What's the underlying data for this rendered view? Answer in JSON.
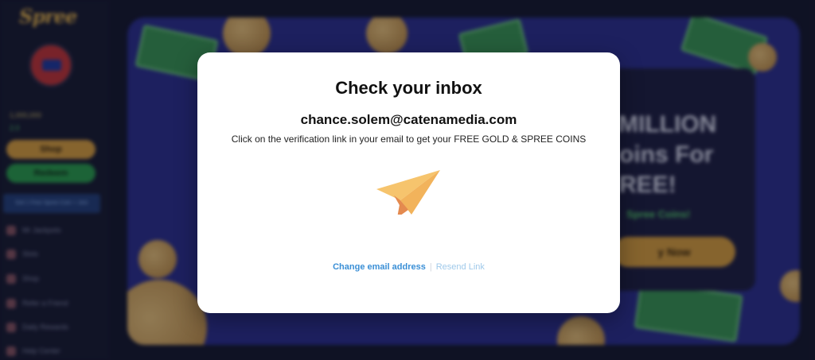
{
  "sidebar": {
    "logo_text": "Spree",
    "balance_gold": "1,000,000",
    "balance_spree": "2.0",
    "shop_label": "Shop",
    "redeem_label": "Redeem",
    "promo_text": "Get 1 Free Spree Coin + Join",
    "nav_items": [
      {
        "label": "Mr Jackpots"
      },
      {
        "label": "Slots"
      },
      {
        "label": "Shop"
      },
      {
        "label": "Refer a Friend"
      },
      {
        "label": "Daily Rewards"
      },
      {
        "label": "Help Center"
      }
    ]
  },
  "banner": {
    "promo_line1": "MILLION",
    "promo_line2": "oins For",
    "promo_line3": "REE!",
    "promo_sub": "Spree Coins!",
    "promo_button": "y Now"
  },
  "modal": {
    "title": "Check your inbox",
    "email": "chance.solem@catenamedia.com",
    "message": "Click on the verification link in your email to get your FREE GOLD & SPREE COINS",
    "icon": "paper-plane-icon",
    "change_email_label": "Change email address",
    "separator": "|",
    "resend_label": "Resend Link"
  },
  "colors": {
    "accent_link": "#3a8fd6",
    "disabled_link": "#9fc9ea",
    "plane_light": "#f6c46d",
    "plane_dark": "#e48a4f"
  }
}
